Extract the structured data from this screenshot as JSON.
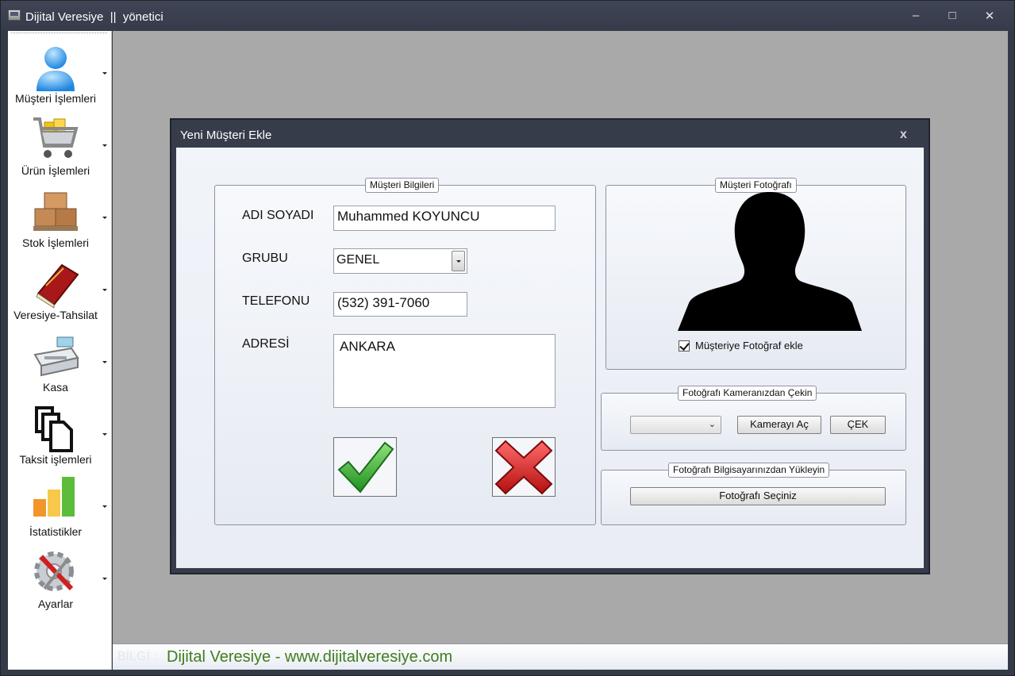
{
  "window": {
    "title": "Dijital Veresiye  ||  yönetici",
    "minimize": "–",
    "maximize": "□",
    "close": "✕"
  },
  "sidebar": {
    "items": [
      {
        "label": "Müşteri İşlemleri",
        "icon": "user-icon"
      },
      {
        "label": "Ürün İşlemleri",
        "icon": "shopping-cart-icon"
      },
      {
        "label": "Stok İşlemleri",
        "icon": "boxes-icon"
      },
      {
        "label": "Veresiye-Tahsilat",
        "icon": "ledger-book-icon"
      },
      {
        "label": "Kasa",
        "icon": "cash-register-icon"
      },
      {
        "label": "Taksit işlemleri",
        "icon": "documents-icon"
      },
      {
        "label": "İstatistikler",
        "icon": "bar-chart-icon"
      },
      {
        "label": "Ayarlar",
        "icon": "settings-gear-icon"
      }
    ]
  },
  "status": {
    "ghost": "BİLGİ :",
    "text": "Dijital Veresiye - www.dijitalveresiye.com"
  },
  "dialog": {
    "title": "Yeni Müşteri Ekle",
    "close": "x",
    "customer_info": {
      "legend": "Müşteri Bilgileri",
      "name_label": "ADI SOYADI",
      "name_value": "Muhammed KOYUNCU",
      "group_label": "GRUBU",
      "group_value": "GENEL",
      "phone_label": "TELEFONU",
      "phone_value": "(532) 391-7060",
      "address_label": "ADRESİ",
      "address_value": "ANKARA"
    },
    "photo": {
      "legend": "Müşteri Fotoğrafı",
      "checkbox_label": "Müşteriye Fotoğraf ekle",
      "checked": true
    },
    "camera": {
      "legend": "Fotoğrafı Kameranızdan Çekin",
      "open_label": "Kamerayı Aç",
      "capture_label": "ÇEK"
    },
    "upload": {
      "legend": "Fotoğrafı Bilgisayarınızdan Yükleyin",
      "choose_label": "Fotoğrafı Seçiniz"
    }
  },
  "colors": {
    "titlebar": "#3f4555",
    "workspace": "#a9a9a9",
    "status_text": "#3f7d1f",
    "confirm_green": "#3cb43c",
    "cancel_red": "#d81e1e"
  }
}
